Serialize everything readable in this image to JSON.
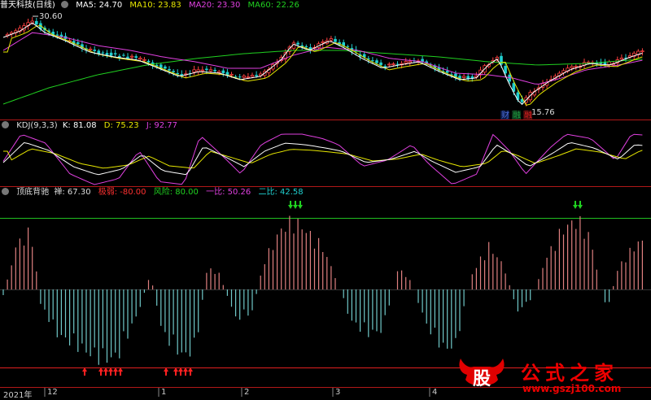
{
  "main": {
    "title": "普天科技(日线)",
    "ma": [
      {
        "label": "MA5: 24.70",
        "color": "#ffffff"
      },
      {
        "label": "MA10: 23.83",
        "color": "#e6e600"
      },
      {
        "label": "MA20: 23.30",
        "color": "#e040e0"
      },
      {
        "label": "MA60: 22.26",
        "color": "#20d020"
      }
    ],
    "high_label": "30.60",
    "low_label": "15.76",
    "tags": [
      {
        "text": "财",
        "color": "#4a6cd8"
      },
      {
        "text": "融",
        "color": "#20a040"
      },
      {
        "text": "融",
        "color": "#e02020"
      }
    ]
  },
  "kdj": {
    "title": "KDJ(9,3,3)",
    "k": "K: 81.08",
    "d": "D: 75.23",
    "j": "J: 92.77",
    "colors": {
      "k": "#ffffff",
      "d": "#e6e600",
      "j": "#e040e0"
    }
  },
  "ind": {
    "title": "顶底背驰",
    "items": [
      {
        "label": "禅: 67.30",
        "color": "#dddddd"
      },
      {
        "label": "极弱: -80.00",
        "color": "#ff3030"
      },
      {
        "label": "风险: 80.00",
        "color": "#20d020"
      },
      {
        "label": "一比: 50.26",
        "color": "#e040e0"
      },
      {
        "label": "二比: 42.58",
        "color": "#20d0d0"
      }
    ]
  },
  "xaxis": {
    "labels": [
      {
        "text": "2021年",
        "x": 4
      },
      {
        "text": "12",
        "x": 58
      },
      {
        "text": "1",
        "x": 198
      },
      {
        "text": "2",
        "x": 300
      },
      {
        "text": "3",
        "x": 412
      },
      {
        "text": "4",
        "x": 531
      }
    ]
  },
  "watermark": {
    "logo_char": "股",
    "title": "公式之家",
    "url": "www.gszj100.com"
  },
  "chart_data": [
    {
      "type": "line",
      "title": "普天科技(日线)",
      "xlabel": "",
      "ylabel": "",
      "series": [
        {
          "name": "MA5",
          "last": 24.7
        },
        {
          "name": "MA10",
          "last": 23.83
        },
        {
          "name": "MA20",
          "last": 23.3
        },
        {
          "name": "MA60",
          "last": 22.26
        }
      ],
      "annotations": [
        "30.60",
        "15.76"
      ]
    },
    {
      "type": "line",
      "title": "KDJ(9,3,3)",
      "series": [
        {
          "name": "K",
          "last": 81.08
        },
        {
          "name": "D",
          "last": 75.23
        },
        {
          "name": "J",
          "last": 92.77
        }
      ]
    },
    {
      "type": "bar",
      "title": "顶底背驰",
      "series": [
        {
          "name": "禅",
          "last": 67.3
        },
        {
          "name": "极弱",
          "last": -80.0
        },
        {
          "name": "风险",
          "last": 80.0
        },
        {
          "name": "一比",
          "last": 50.26
        },
        {
          "name": "二比",
          "last": 42.58
        }
      ]
    }
  ]
}
